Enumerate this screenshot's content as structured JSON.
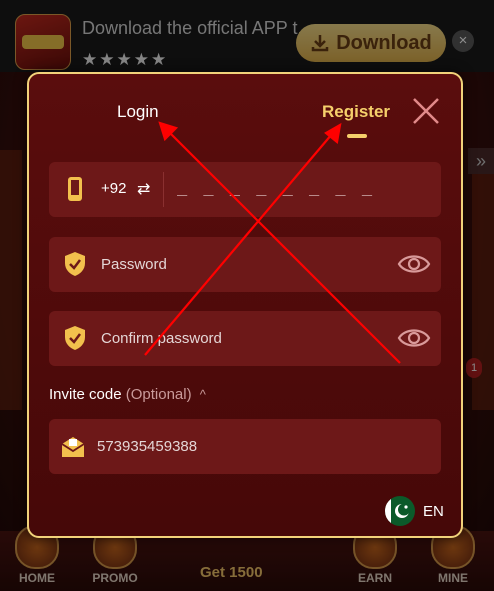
{
  "banner": {
    "app_text": "Download the official APP t...",
    "stars": "★★★★★",
    "download_label": "Download",
    "close": "×"
  },
  "background": {
    "arrow": "»",
    "badge": "1",
    "nav": {
      "home": "HOME",
      "promo": "PROMO",
      "get": "Get 1500",
      "earn": "EARN",
      "mine": "MINE"
    }
  },
  "modal": {
    "tab_login": "Login",
    "tab_register": "Register",
    "phone": {
      "country_code": "+92",
      "swap": "⇄",
      "placeholder": "_ _ _ _ _ _ _ _ _ _"
    },
    "password_label": "Password",
    "confirm_password_label": "Confirm password",
    "invite": {
      "label": "Invite code",
      "optional": "(Optional)",
      "caret": "^",
      "value": "573935459388"
    },
    "language": "EN"
  },
  "colors": {
    "accent": "#f5cf6b",
    "modal_bg": "#4f0b0b",
    "field_bg": "#6d1818",
    "annotation": "#ff0000"
  },
  "icons": [
    "phone-icon",
    "swap-icon",
    "shield-check-icon",
    "eye-icon",
    "envelope-icon",
    "pakistan-flag-icon",
    "close-icon",
    "download-icon"
  ]
}
